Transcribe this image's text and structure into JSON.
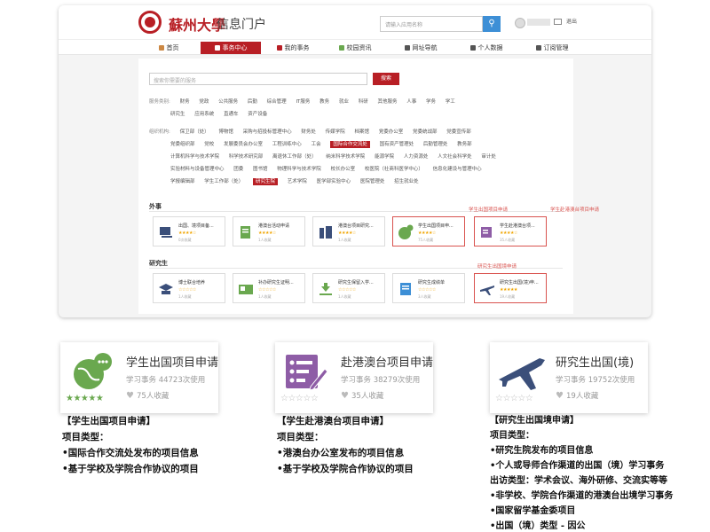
{
  "header": {
    "logo_text": "蘇州大學",
    "portal_title": "信息门户",
    "search_placeholder": "请输入应用名称",
    "search_icon": "search-icon",
    "logout": "退出"
  },
  "nav": {
    "items": [
      {
        "label": "首页",
        "active": false
      },
      {
        "label": "事务中心",
        "active": true
      },
      {
        "label": "我的事务",
        "active": false
      },
      {
        "label": "校园资讯",
        "active": false
      },
      {
        "label": "网址导航",
        "active": false
      },
      {
        "label": "个人数据",
        "active": false
      },
      {
        "label": "订阅管理",
        "active": false
      }
    ]
  },
  "service_search": {
    "placeholder": "搜索你需要的服务",
    "button": "搜索"
  },
  "filters": {
    "category_label": "服务类别:",
    "categories_row1": [
      "财务",
      "党政",
      "公共服务",
      "后勤",
      "综合管理",
      "IT服务",
      "教务",
      "就业",
      "科研",
      "其他服务",
      "人事",
      "学务",
      "学工"
    ],
    "categories_row2": [
      "研究生",
      "应用系统",
      "直通车",
      "资产设备"
    ],
    "org_label": "组织机构:",
    "org_rows": [
      [
        "保卫部（处）",
        "博物馆",
        "采购与招投标管理中心",
        "财务处",
        "传媒学院",
        "档案馆",
        "党委办公室",
        "党委统战部",
        "党委宣传部"
      ],
      [
        "党委组织部",
        "党校",
        "发展委员会办公室",
        "工程训练中心",
        "工会",
        "国际合作交流处",
        "国有资产管理处",
        "后勤管理处",
        "教务部"
      ],
      [
        "计算机科学与技术学院",
        "科学技术研究部",
        "离退休工作部（处）",
        "纳米科学技术学院",
        "能源学院",
        "人力资源处",
        "人文社会科学处",
        "审计处"
      ],
      [
        "实验材料与设备管理中心",
        "团委",
        "图书馆",
        "物理科学与技术学院",
        "校长办公室",
        "校医院（社商科医学中心）",
        "信息化建设与管理中心"
      ],
      [
        "学报编辑部",
        "学生工作部（处）",
        "研究生院",
        "艺术学院",
        "医学部实验中心",
        "医院管理处",
        "招生就业处"
      ]
    ],
    "selected_tag_1": "国际合作交流处",
    "selected_tag_2": "研究生院"
  },
  "sections": [
    {
      "title": "外事",
      "cards": [
        {
          "title": "出国、境项目备...",
          "count": "0次收藏",
          "highlight": false,
          "icon": "user-desk-icon"
        },
        {
          "title": "港澳台活动申请",
          "count": "1人收藏",
          "highlight": false,
          "icon": "document-edit-icon"
        },
        {
          "title": "港澳台项目研究...",
          "count": "1人收藏",
          "highlight": false,
          "icon": "building-icon"
        },
        {
          "title": "学生出国项目申...",
          "count": "75人收藏",
          "highlight": true,
          "icon": "globe-chat-icon",
          "label": "学生出国项目申请"
        },
        {
          "title": "学生赴港澳台项...",
          "count": "35人收藏",
          "highlight": true,
          "icon": "form-pen-icon",
          "label": "学生赴港澳台项目申请"
        }
      ]
    },
    {
      "title": "研究生",
      "cards": [
        {
          "title": "博士联合培养",
          "count": "1人收藏",
          "highlight": false,
          "icon": "graduation-icon"
        },
        {
          "title": "补办研究生证明...",
          "count": "1人收藏",
          "highlight": false,
          "icon": "id-card-icon"
        },
        {
          "title": "研究生保留入学...",
          "count": "1人收藏",
          "highlight": false,
          "icon": "download-icon"
        },
        {
          "title": "研究生成绩单",
          "count": "3人收藏",
          "highlight": false,
          "icon": "transcript-icon"
        },
        {
          "title": "研究生出国(境)申...",
          "count": "19人收藏",
          "highlight": true,
          "icon": "airplane-icon",
          "label": "研究生出国境申请"
        }
      ]
    }
  ],
  "big_cards": [
    {
      "title": "学生出国项目申请",
      "stats": "学习事务 44723次使用",
      "likes": "75人收藏"
    },
    {
      "title": "赴港澳台项目申请",
      "stats": "学习事务 38279次使用",
      "likes": "35人收藏"
    },
    {
      "title": "研究生出国(境)",
      "stats": "学习事务 19752次使用",
      "likes": "19人收藏"
    }
  ],
  "descriptions": [
    {
      "lines": [
        "【学生出国项目申请】",
        "项目类型：",
        "•国际合作交流处发布的项目信息",
        "•基于学校及学院合作协议的项目"
      ]
    },
    {
      "lines": [
        "【学生赴港澳台项目申请】",
        "项目类型：",
        "•港澳台办公室发布的项目信息",
        "•基于学校及学院合作协议的项目"
      ]
    },
    {
      "lines": [
        "【研究生出国境申请】",
        "项目类型：",
        "•研究生院发布的项目信息",
        "•个人或导师合作渠道的出国（境）学习事务",
        "出访类型：学术会议、海外研修、交流实等等",
        "•非学校、学院合作渠道的港澳台出境学习事务",
        "•国家留学基金委项目",
        "•出国（境）类型 - 因公"
      ]
    }
  ],
  "colors": {
    "brand": "#b81f25",
    "highlight": "#d9534f",
    "star": "#f0a500",
    "green": "#6aa84f"
  }
}
